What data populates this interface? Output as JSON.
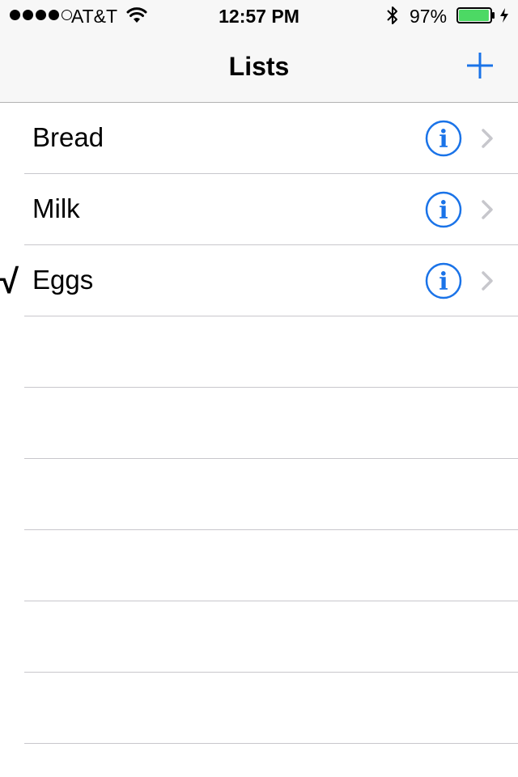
{
  "status_bar": {
    "signal_strength": 4,
    "signal_max": 5,
    "carrier": "AT&T",
    "time": "12:57 PM",
    "battery_percent": "97%",
    "battery_level": 0.97
  },
  "nav": {
    "title": "Lists",
    "add_icon": "plus-icon"
  },
  "lists": [
    {
      "label": "Bread",
      "checked": false
    },
    {
      "label": "Milk",
      "checked": false
    },
    {
      "label": "Eggs",
      "checked": true
    }
  ],
  "icons": {
    "info": "info-circle-icon",
    "chevron": "chevron-right-icon",
    "check": "√"
  },
  "colors": {
    "accent": "#1a73e8",
    "chevron": "#c7c7cc",
    "battery": "#4cd964",
    "separator": "#c8c7cc",
    "bar_background": "#f7f7f7"
  }
}
